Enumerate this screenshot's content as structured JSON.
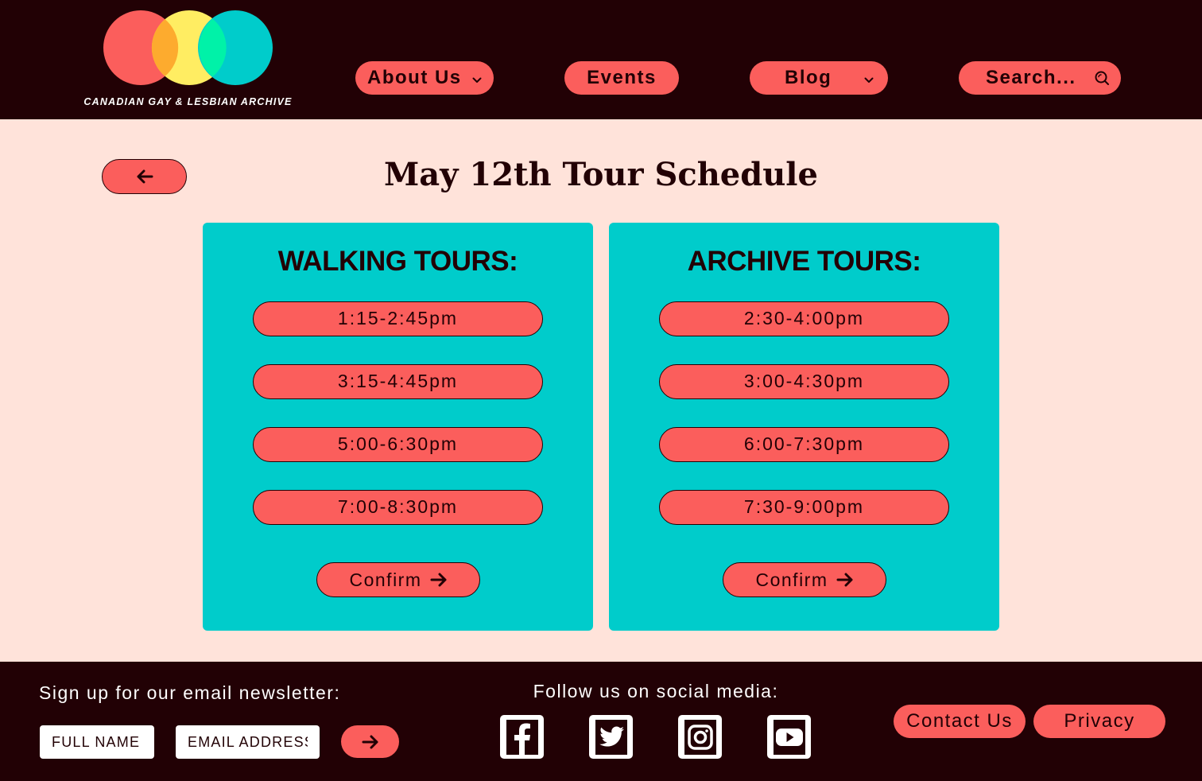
{
  "header": {
    "logo_text": "CANADIAN GAY & LESBIAN ARCHIVE",
    "nav": {
      "about": "About Us",
      "events": "Events",
      "blog": "Blog",
      "search_placeholder": "Search..."
    }
  },
  "main": {
    "title": "May 12th Tour Schedule",
    "walking": {
      "title": "WALKING TOURS:",
      "slots": [
        "1:15-2:45pm",
        "3:15-4:45pm",
        "5:00-6:30pm",
        "7:00-8:30pm"
      ],
      "confirm_label": "Confirm"
    },
    "archive": {
      "title": "ARCHIVE TOURS:",
      "slots": [
        "2:30-4:00pm",
        "3:00-4:30pm",
        "6:00-7:30pm",
        "7:30-9:00pm"
      ],
      "confirm_label": "Confirm"
    }
  },
  "footer": {
    "newsletter_label": "Sign up for our email newsletter:",
    "name_placeholder": "FULL NAME",
    "email_placeholder": "EMAIL ADDRESS",
    "social_label": "Follow us on social media:",
    "social_icons": [
      "facebook-icon",
      "twitter-icon",
      "instagram-icon",
      "youtube-icon"
    ],
    "contact_label": "Contact Us",
    "privacy_label": "Privacy"
  },
  "colors": {
    "dark": "#220105",
    "coral": "#fb5e5c",
    "teal": "#00cccb",
    "cream": "#ffe3da"
  }
}
